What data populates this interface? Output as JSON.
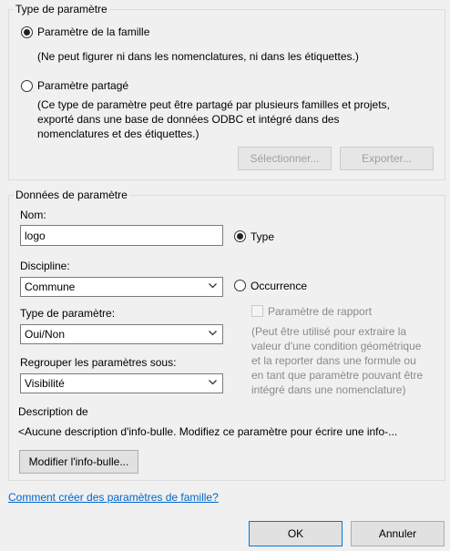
{
  "type_group": {
    "legend": "Type de paramètre",
    "family_radio_label": "Paramètre de la famille",
    "family_desc": "(Ne peut figurer ni dans les nomenclatures, ni dans les étiquettes.)",
    "shared_radio_label": "Paramètre partagé",
    "shared_desc_lines": [
      "(Ce type de paramètre peut être partagé par plusieurs familles et projets,",
      "exporté dans une base de données ODBC et intégré dans des",
      "nomenclatures et des étiquettes.)"
    ],
    "select_button": "Sélectionner...",
    "export_button": "Exporter..."
  },
  "data_group": {
    "legend": "Données de paramètre",
    "name_label": "Nom:",
    "name_value": "logo",
    "type_radio_label": "Type",
    "discipline_label": "Discipline:",
    "discipline_value": "Commune",
    "occurrence_radio_label": "Occurrence",
    "param_type_label": "Type de paramètre:",
    "param_type_value": "Oui/Non",
    "report_checkbox_label": "Paramètre de rapport",
    "report_desc_lines": [
      "(Peut être utilisé pour extraire la",
      "valeur d'une condition géométrique",
      "et la reporter dans une formule ou",
      "en tant que paramètre pouvant être",
      "intégré dans une nomenclature)"
    ],
    "group_label": "Regrouper les paramètres sous:",
    "group_value": "Visibilité",
    "description_label": "Description de",
    "tooltip_text": "<Aucune description d'info-bulle. Modifiez ce paramètre pour écrire une info-...",
    "edit_tooltip_button": "Modifier l'info-bulle..."
  },
  "help_link": "Comment créer des paramètres de famille?",
  "footer": {
    "ok_button": "OK",
    "cancel_button": "Annuler"
  }
}
